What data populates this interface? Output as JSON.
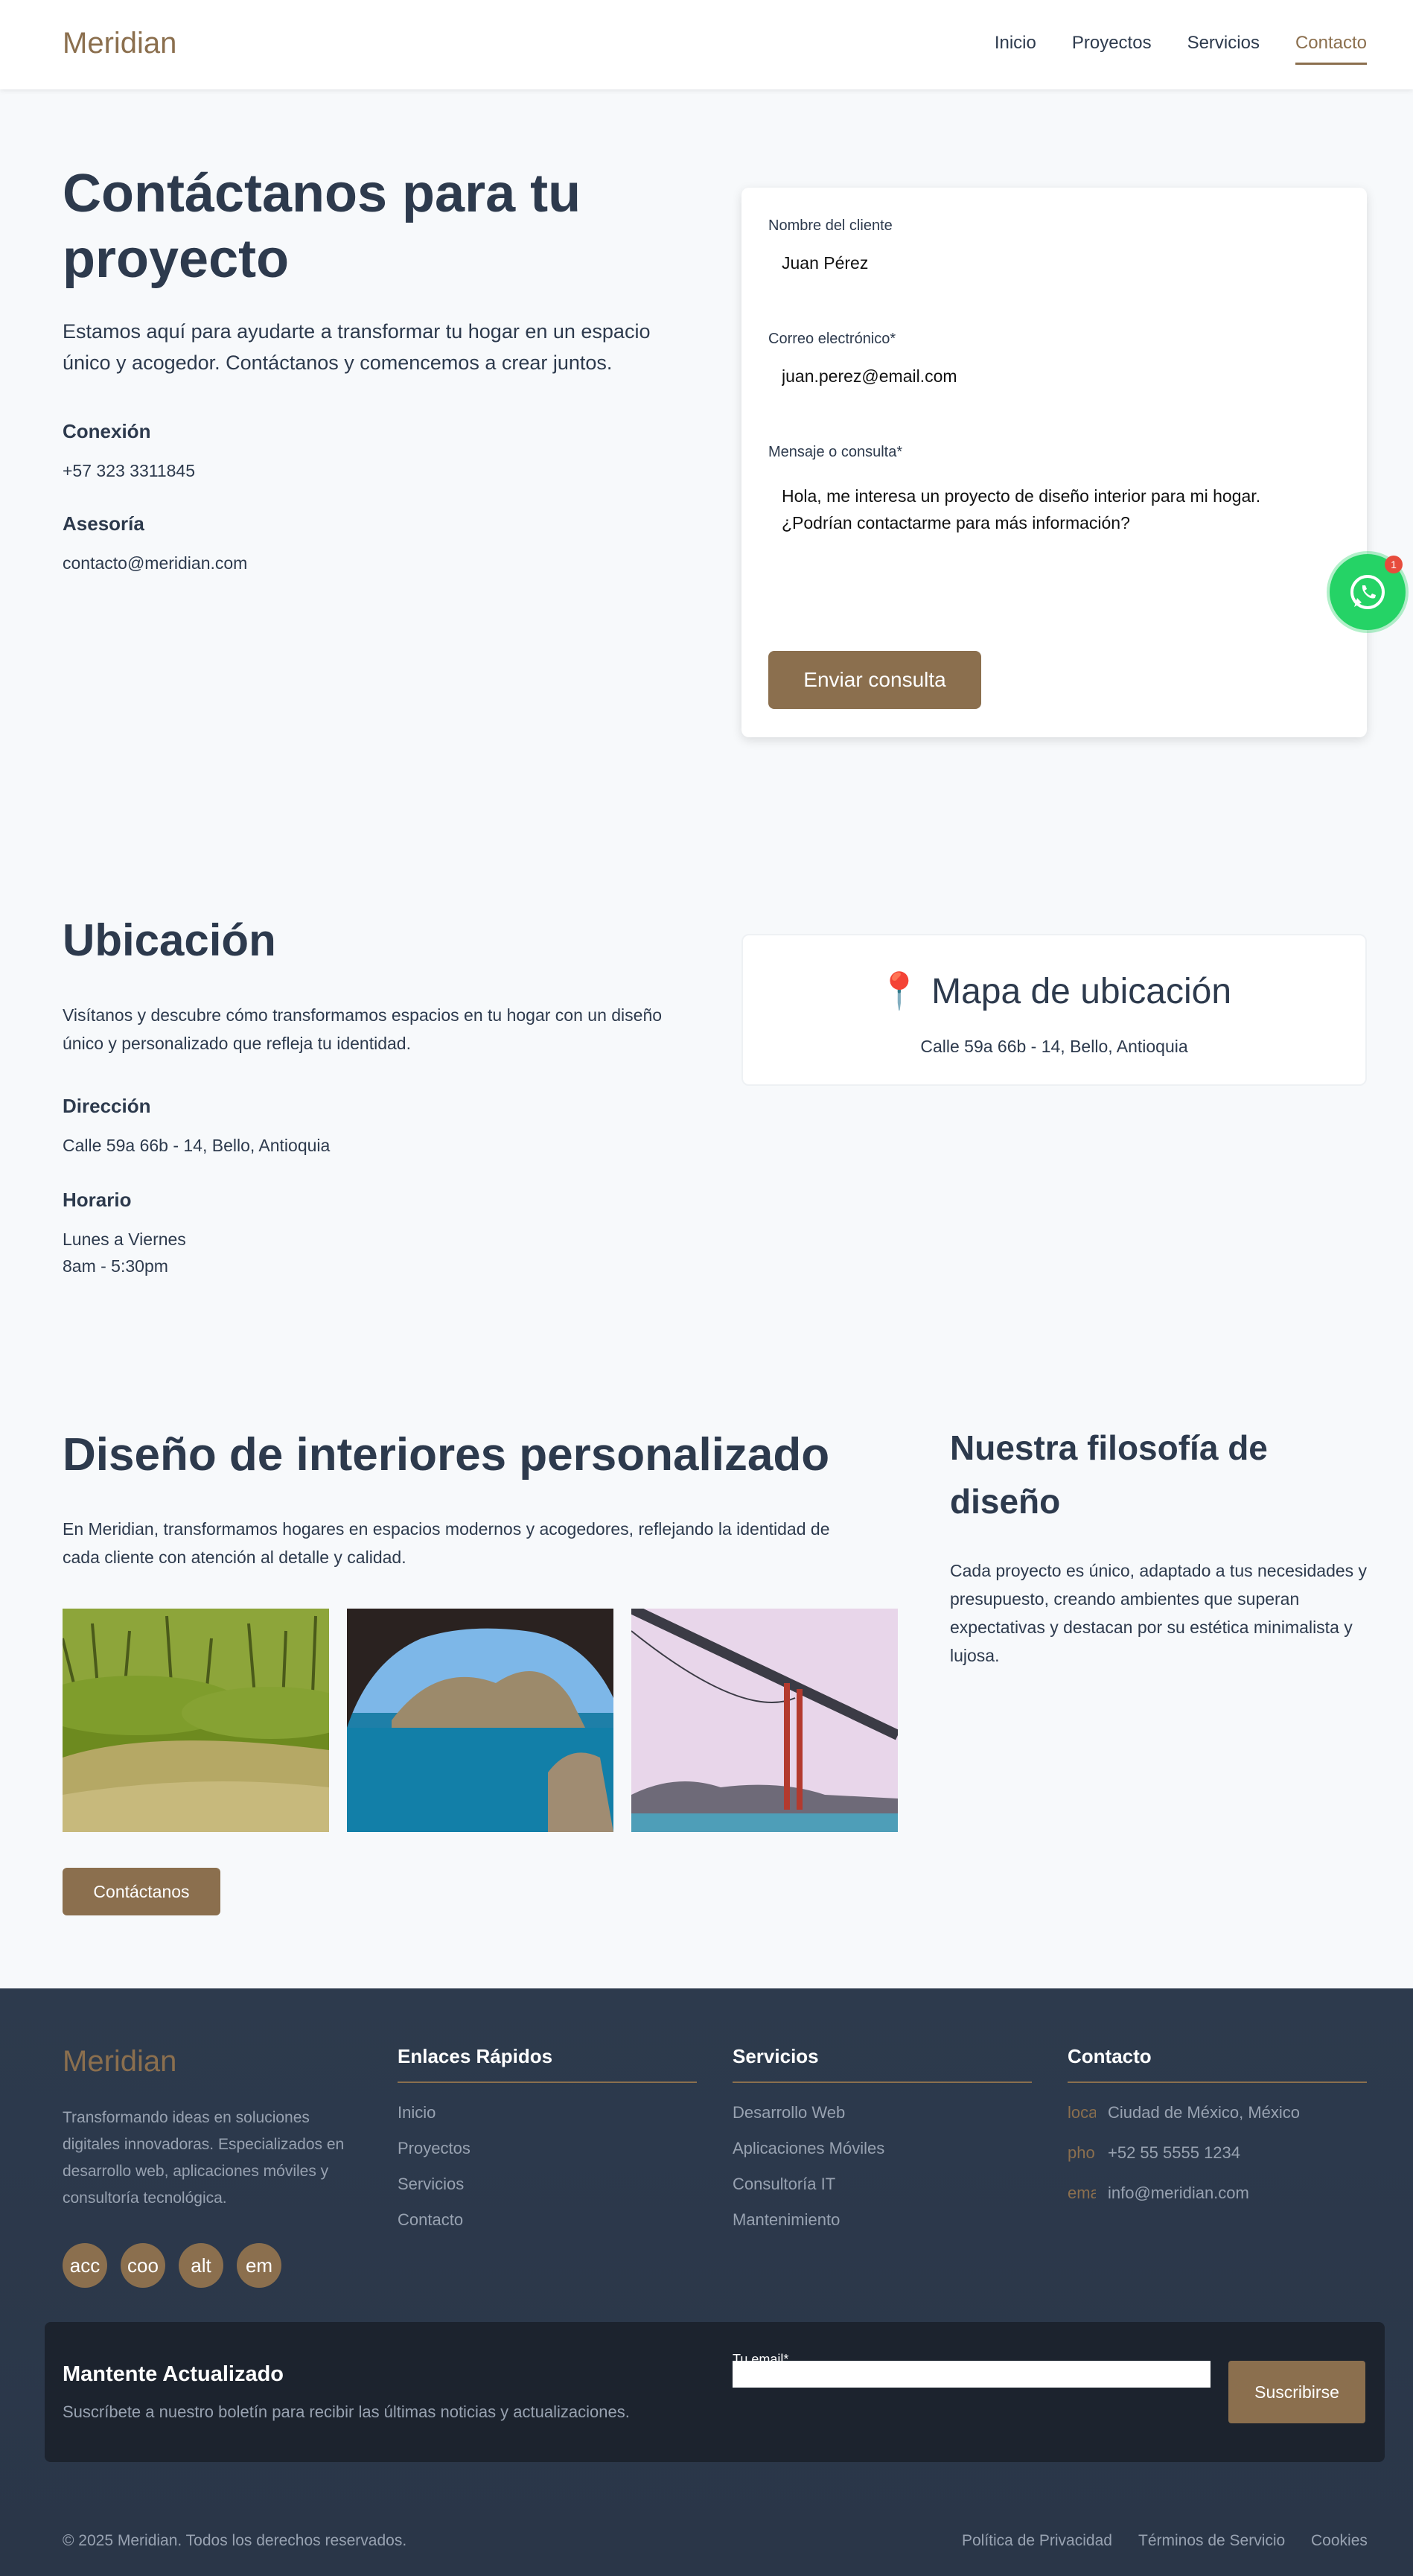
{
  "nav": {
    "logo": "Meridian",
    "links": [
      "Inicio",
      "Proyectos",
      "Servicios",
      "Contacto"
    ],
    "active": "Contacto"
  },
  "contact": {
    "title": "Contáctanos para tu proyecto",
    "subtitle": "Estamos aquí para ayudarte a transformar tu hogar en un espacio único y acogedor. Contáctanos y comencemos a crear juntos.",
    "connection_label": "Conexión",
    "connection_value": "+57 323 3311845",
    "advice_label": "Asesoría",
    "advice_value": "contacto@meridian.com"
  },
  "form": {
    "name_label": "Nombre del cliente",
    "name_value": "Juan Pérez",
    "email_label": "Correo electrónico*",
    "email_value": "juan.perez@email.com",
    "message_label": "Mensaje o consulta*",
    "message_value": "Hola, me interesa un proyecto de diseño interior para mi hogar. ¿Podrían contactarme para más información?",
    "submit_label": "Enviar consulta"
  },
  "whatsapp": {
    "badge": "1",
    "icon": "whatsapp-icon"
  },
  "location": {
    "title": "Ubicación",
    "text": "Visítanos y descubre cómo transformamos espacios en tu hogar con un diseño único y personalizado que refleja tu identidad.",
    "address_label": "Dirección",
    "address_value": "Calle 59a 66b - 14, Bello, Antioquia",
    "hours_label": "Horario",
    "hours_days": "Lunes a Viernes",
    "hours_time": "8am - 5:30pm",
    "map_pin": "📍",
    "map_title": "Mapa de ubicación",
    "map_address": "Calle 59a 66b - 14, Bello, Antioquia"
  },
  "design": {
    "title": "Diseño de interiores personalizado",
    "text": "En Meridian, transformamos hogares en espacios modernos y acogedores, reflejando la identidad de cada cliente con atención al detalle y calidad.",
    "images": [
      "forest-image",
      "sea-cave-image",
      "golden-gate-bridge-image"
    ],
    "cta": "Contáctanos",
    "philosophy_title": "Nuestra filosofía de diseño",
    "philosophy_text": "Cada proyecto es único, adaptado a tus necesidades y presupuesto, creando ambientes que superan expectativas y destacan por su estética minimalista y lujosa."
  },
  "footer": {
    "logo": "Meridian",
    "description": "Transformando ideas en soluciones digitales innovadoras. Especializados en desarrollo web, aplicaciones móviles y consultoría tecnológica.",
    "social": [
      "acc",
      "coo",
      "alt",
      "em"
    ],
    "quick_title": "Enlaces Rápidos",
    "quick_links": [
      "Inicio",
      "Proyectos",
      "Servicios",
      "Contacto"
    ],
    "services_title": "Servicios",
    "services": [
      "Desarrollo Web",
      "Aplicaciones Móviles",
      "Consultoría IT",
      "Mantenimiento"
    ],
    "contact_title": "Contacto",
    "contact_items": [
      {
        "icon": "loca",
        "value": "Ciudad de México, México"
      },
      {
        "icon": "pho",
        "value": "+52 55 5555 1234"
      },
      {
        "icon": "ema",
        "value": "info@meridian.com"
      }
    ],
    "newsletter_title": "Mantente Actualizado",
    "newsletter_sub": "Suscríbete a nuestro boletín para recibir las últimas noticias y actualizaciones.",
    "newsletter_label": "Tu email*",
    "newsletter_button": "Suscribirse",
    "copyright": "© 2025 Meridian. Todos los derechos reservados.",
    "legal": [
      "Política de Privacidad",
      "Términos de Servicio",
      "Cookies"
    ]
  },
  "colors": {
    "accent": "#8b6f4e",
    "text": "#2d3a4d",
    "footer_bg": "#2d3a4d",
    "whatsapp": "#25d366"
  }
}
